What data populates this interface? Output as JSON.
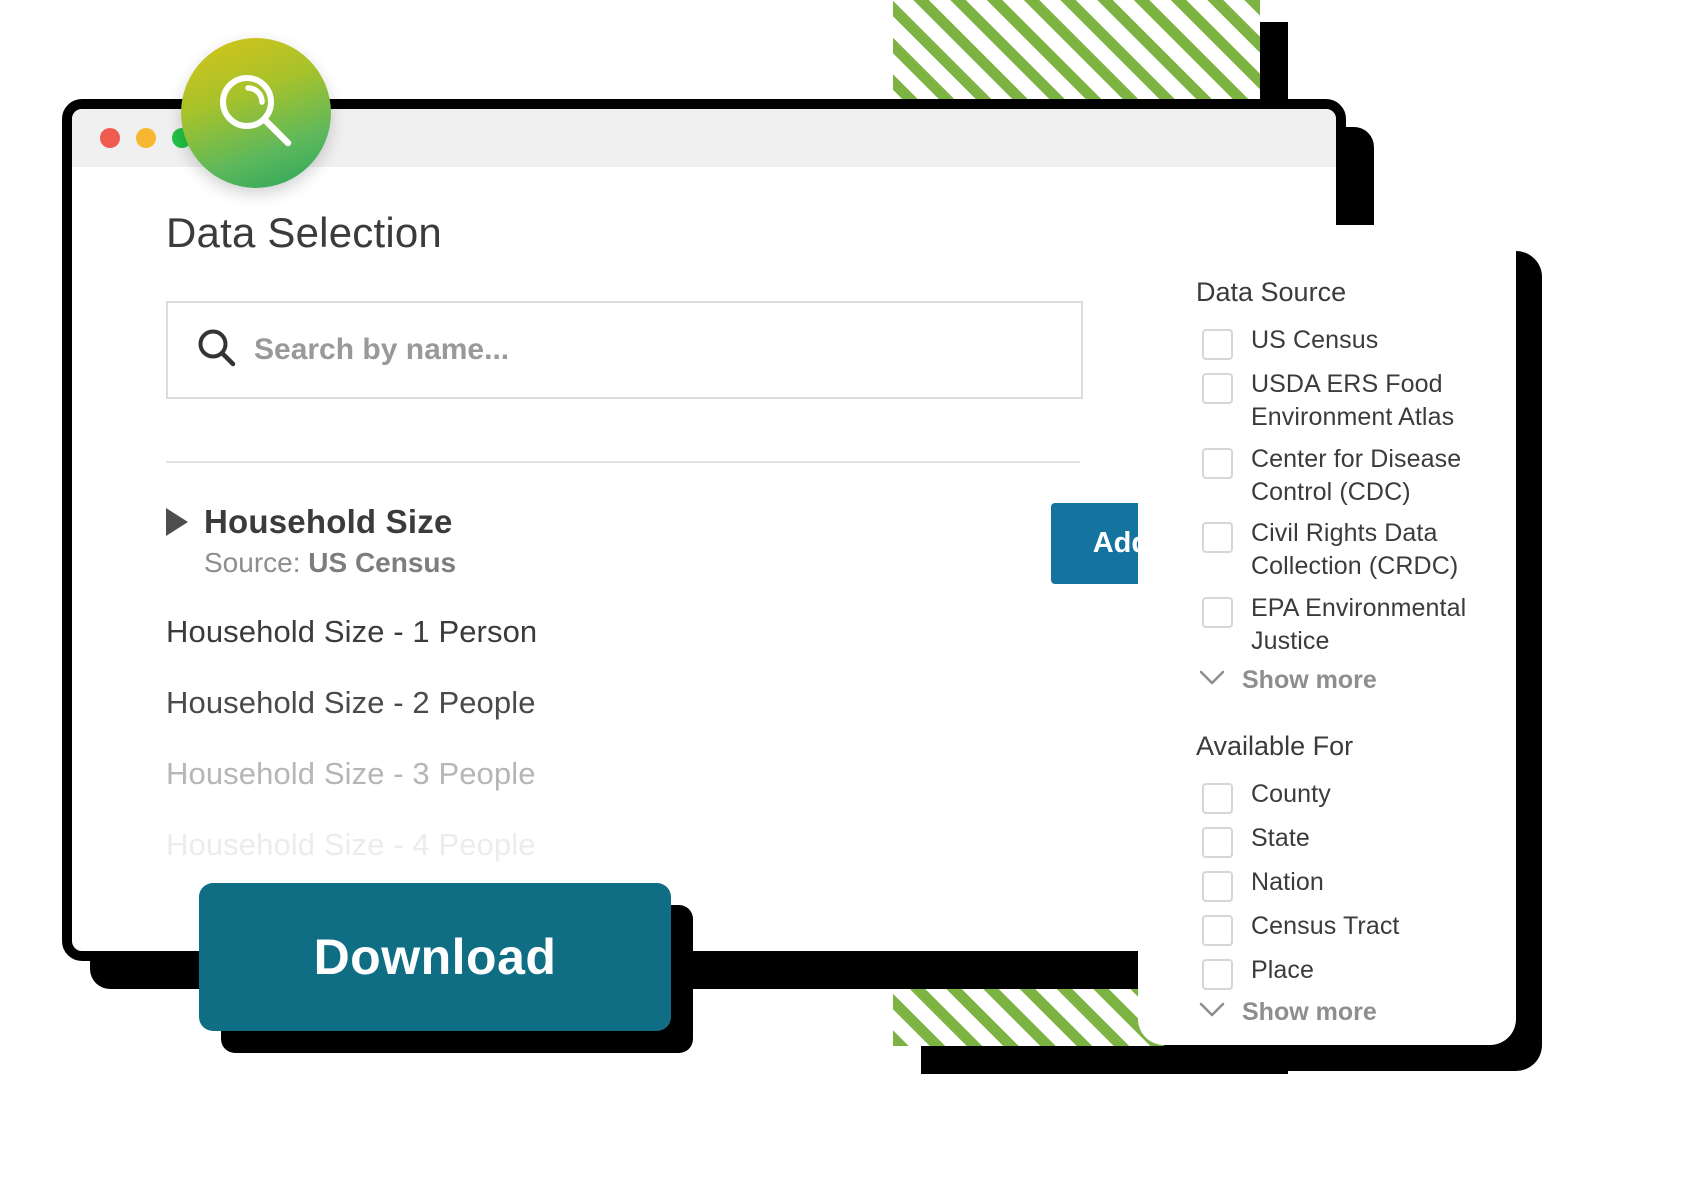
{
  "window": {
    "traffic_lights": [
      "close",
      "minimize",
      "maximize"
    ],
    "colors": {
      "close": "#f05b4f",
      "minimize": "#f7b731",
      "maximize": "#22c246",
      "add_data_blue": "#14739f",
      "download_teal": "#0f6e84",
      "stripe_green": "#7cb342"
    }
  },
  "logo": {
    "icon": "magnifier-icon"
  },
  "main": {
    "title": "Data Selection",
    "search": {
      "icon": "search-icon",
      "placeholder": "Search by name...",
      "value": ""
    },
    "result_group": {
      "disclosure_icon": "triangle-right-icon",
      "title": "Household Size",
      "source_label": "Source:",
      "source_name": "US Census",
      "add_button_label": "Add Data",
      "items": [
        "Household Size - 1 Person",
        "Household Size - 2 People",
        "Household Size - 3 People",
        "Household Size - 4 People"
      ]
    },
    "download_label": "Download"
  },
  "filters": {
    "data_source": {
      "heading": "Data Source",
      "options": [
        "US Census",
        "USDA ERS Food Environment Atlas",
        "Center for Disease Control (CDC)",
        "Civil Rights Data Collection (CRDC)",
        "EPA Environmental Justice"
      ],
      "show_more_label": "Show more",
      "show_more_icon": "chevron-down-icon"
    },
    "available_for": {
      "heading": "Available For",
      "options": [
        "County",
        "State",
        "Nation",
        "Census Tract",
        "Place"
      ],
      "show_more_label": "Show more",
      "show_more_icon": "chevron-down-icon"
    }
  }
}
